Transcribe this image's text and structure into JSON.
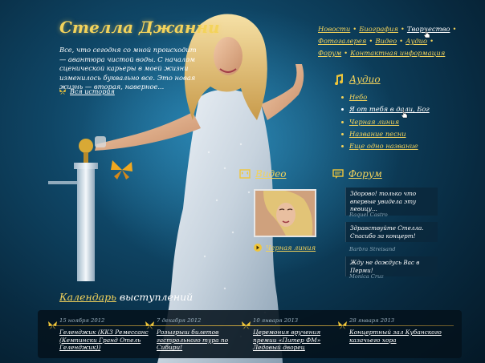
{
  "site": {
    "title": "Стелла Джанни",
    "intro": "Все, что сегодня со мной происходит — авантюра чистой воды. С началом сценической карьеры в моей жизни изменилось буквально все. Это новая жизнь — вторая, наверное...",
    "all_history": "Вся история"
  },
  "nav": {
    "row1": [
      "Новости",
      "Биография",
      "Творчество"
    ],
    "row2": [
      "Фотогалерея",
      "Видео",
      "Аудио"
    ],
    "row3": [
      "Форум",
      "Контактная информация"
    ]
  },
  "audio": {
    "heading": "Аудио",
    "tracks": [
      "Небо",
      "Я от тебя в дали, Бог",
      "Черная линия",
      "Название песни",
      "Еще одно название"
    ]
  },
  "video": {
    "heading": "Видео",
    "caption": "Черная линия"
  },
  "forum": {
    "heading": "Форум",
    "posts": [
      {
        "text": "Здорово! только что впервые увидела эту певицу...",
        "author": "Raquel Castro"
      },
      {
        "text": "Здравствуйте Стелла. Спасибо за концерт!",
        "author": "Barbra Streisand"
      },
      {
        "text": "Жду не дождусь Вас в Перми!",
        "author": "Monica Cruz"
      }
    ]
  },
  "calendar": {
    "title_hl": "Календарь",
    "title_rest": " выступлений",
    "events": [
      {
        "date": "15 ноября 2012",
        "text": "Геленджик (ККЗ Ремесcанс (Кемпински Гранд Отель Геленджик))"
      },
      {
        "date": "7 декабря 2012",
        "text": "Розыгрыш билетов гастрольного тура по Сибири!"
      },
      {
        "date": "10 января 2013",
        "text": "Церемония вручения премии «Питер ФМ» Ледовый дворец"
      },
      {
        "date": "28 января 2013",
        "text": "Концертный зал Кубанского казачьего хора"
      }
    ]
  },
  "colors": {
    "accent": "#f3d35b",
    "bg_dark": "#041826",
    "bg_mid": "#0f4666"
  }
}
